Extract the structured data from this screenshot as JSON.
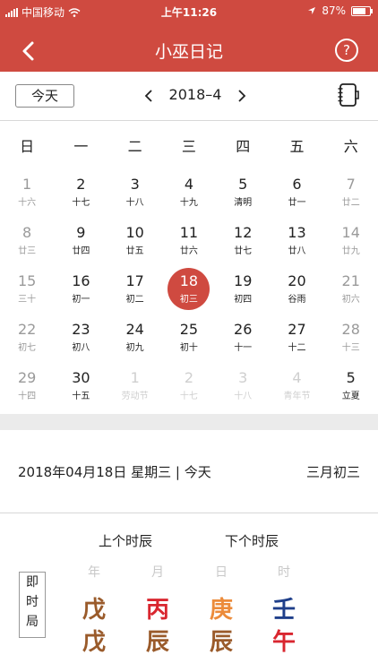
{
  "status_bar": {
    "carrier": "中国移动",
    "time": "上午11:26",
    "battery": "87%",
    "battery_level": 0.87
  },
  "nav": {
    "title": "小巫日记",
    "help_label": "?"
  },
  "toolbar": {
    "today_label": "今天",
    "month_label": "2018–4",
    "prev_label": "<",
    "next_label": ">"
  },
  "weekdays": [
    "日",
    "一",
    "二",
    "三",
    "四",
    "五",
    "六"
  ],
  "calendar": {
    "weeks": [
      [
        {
          "d": "1",
          "l": "十六",
          "s": "weekend"
        },
        {
          "d": "2",
          "l": "十七"
        },
        {
          "d": "3",
          "l": "十八"
        },
        {
          "d": "4",
          "l": "十九"
        },
        {
          "d": "5",
          "l": "清明"
        },
        {
          "d": "6",
          "l": "廿一"
        },
        {
          "d": "7",
          "l": "廿二",
          "s": "weekend"
        }
      ],
      [
        {
          "d": "8",
          "l": "廿三",
          "s": "weekend"
        },
        {
          "d": "9",
          "l": "廿四"
        },
        {
          "d": "10",
          "l": "廿五"
        },
        {
          "d": "11",
          "l": "廿六"
        },
        {
          "d": "12",
          "l": "廿七"
        },
        {
          "d": "13",
          "l": "廿八"
        },
        {
          "d": "14",
          "l": "廿九",
          "s": "weekend"
        }
      ],
      [
        {
          "d": "15",
          "l": "三十",
          "s": "weekend"
        },
        {
          "d": "16",
          "l": "初一"
        },
        {
          "d": "17",
          "l": "初二"
        },
        {
          "d": "18",
          "l": "初三",
          "s": "selected"
        },
        {
          "d": "19",
          "l": "初四"
        },
        {
          "d": "20",
          "l": "谷雨"
        },
        {
          "d": "21",
          "l": "初六",
          "s": "weekend"
        }
      ],
      [
        {
          "d": "22",
          "l": "初七",
          "s": "weekend"
        },
        {
          "d": "23",
          "l": "初八"
        },
        {
          "d": "24",
          "l": "初九"
        },
        {
          "d": "25",
          "l": "初十"
        },
        {
          "d": "26",
          "l": "十一"
        },
        {
          "d": "27",
          "l": "十二"
        },
        {
          "d": "28",
          "l": "十三",
          "s": "weekend"
        }
      ],
      [
        {
          "d": "29",
          "l": "十四",
          "s": "weekend"
        },
        {
          "d": "30",
          "l": "十五"
        },
        {
          "d": "1",
          "l": "劳动节",
          "s": "other"
        },
        {
          "d": "2",
          "l": "十七",
          "s": "other"
        },
        {
          "d": "3",
          "l": "十八",
          "s": "other"
        },
        {
          "d": "4",
          "l": "青年节",
          "s": "other"
        },
        {
          "d": "5",
          "l": "立夏"
        }
      ]
    ]
  },
  "day_info": {
    "date_text": "2018年04月18日 星期三 | 今天",
    "lunar_text": "三月初三"
  },
  "shichen": {
    "prev_label": "上个时辰",
    "next_label": "下个时辰"
  },
  "jishi": {
    "chars": [
      "即",
      "时",
      "局"
    ]
  },
  "pillars": {
    "labels": [
      "年",
      "月",
      "日",
      "时"
    ],
    "top": [
      {
        "char": "戊",
        "color": "#9a5b2b"
      },
      {
        "char": "丙",
        "color": "#d9262f"
      },
      {
        "char": "庚",
        "color": "#ec8b3a"
      },
      {
        "char": "壬",
        "color": "#1f3f8a"
      }
    ],
    "bottom": [
      {
        "char": "戊",
        "color": "#9a5b2b"
      },
      {
        "char": "辰",
        "color": "#9a5b2b"
      },
      {
        "char": "辰",
        "color": "#9a5b2b"
      },
      {
        "char": "午",
        "color": "#d9262f"
      }
    ]
  },
  "colors": {
    "accent": "#cf4a40"
  }
}
